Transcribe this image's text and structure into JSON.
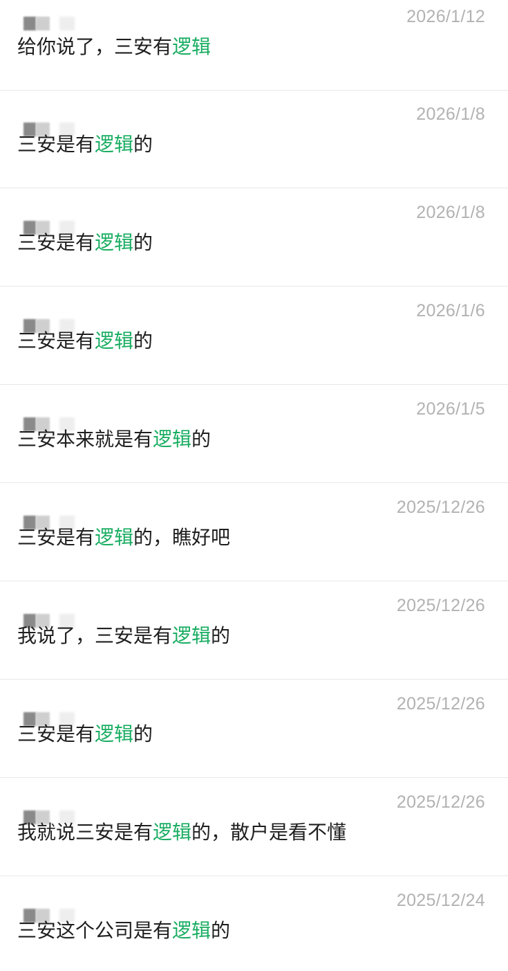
{
  "colors": {
    "highlight": "#1aad62",
    "text": "#1f1f1f",
    "date": "#b2b2b2",
    "divider": "#e8e8e8"
  },
  "items": [
    {
      "date": "2026/1/12",
      "pre": "给你说了，三安有",
      "hl": "逻辑",
      "post": ""
    },
    {
      "date": "2026/1/8",
      "pre": "三安是有",
      "hl": "逻辑",
      "post": "的"
    },
    {
      "date": "2026/1/8",
      "pre": "三安是有",
      "hl": "逻辑",
      "post": "的"
    },
    {
      "date": "2026/1/6",
      "pre": "三安是有",
      "hl": "逻辑",
      "post": "的"
    },
    {
      "date": "2026/1/5",
      "pre": "三安本来就是有",
      "hl": "逻辑",
      "post": "的"
    },
    {
      "date": "2025/12/26",
      "pre": "三安是有",
      "hl": "逻辑",
      "post": "的，瞧好吧"
    },
    {
      "date": "2025/12/26",
      "pre": "我说了，三安是有",
      "hl": "逻辑",
      "post": "的"
    },
    {
      "date": "2025/12/26",
      "pre": "三安是有",
      "hl": "逻辑",
      "post": "的"
    },
    {
      "date": "2025/12/26",
      "pre": "我就说三安是有",
      "hl": "逻辑",
      "post": "的，散户是看不懂"
    },
    {
      "date": "2025/12/24",
      "pre": "三安这个公司是有",
      "hl": "逻辑",
      "post": "的"
    }
  ]
}
